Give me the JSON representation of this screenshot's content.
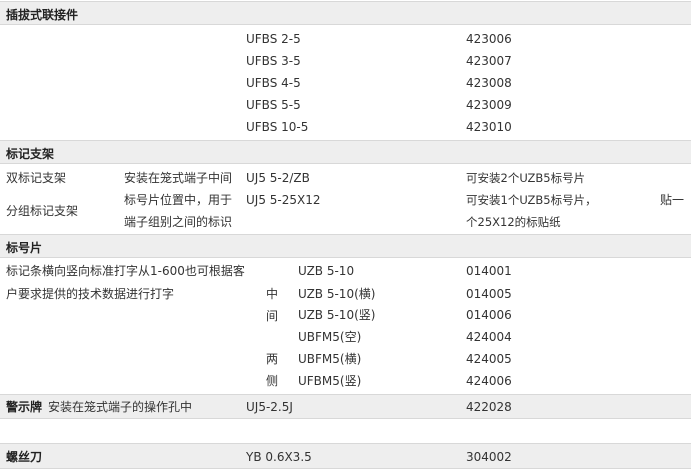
{
  "connectors": {
    "title": "插拔式联接件",
    "rows": [
      {
        "model": "UFBS 2-5",
        "code": "423006"
      },
      {
        "model": "UFBS 3-5",
        "code": "423007"
      },
      {
        "model": "UFBS 4-5",
        "code": "423008"
      },
      {
        "model": "UFBS 5-5",
        "code": "423009"
      },
      {
        "model": "UFBS 10-5",
        "code": "423010"
      }
    ]
  },
  "marker_bracket": {
    "title": "标记支架",
    "names": [
      "双标记支架",
      "分组标记支架"
    ],
    "desc": [
      "安装在笼式端子中间",
      "标号片位置中，用于",
      "端子组别之间的标识"
    ],
    "models": [
      "UJ5 5-2/ZB",
      "UJ5 5-25X12"
    ],
    "notes": [
      "可安装2个UZB5标号片",
      "可安装1个UZB5标号片，",
      "个25X12的标贴纸"
    ],
    "note_extra": "贴一"
  },
  "marker_strip": {
    "title": "标号片",
    "desc": [
      "标记条横向竖向标准打字从1-600也可根据客",
      "户要求提供的技术数据进行打字"
    ],
    "side_labels": [
      "中",
      "间",
      "两",
      "侧"
    ],
    "rows": [
      {
        "model": "UZB 5-10",
        "code": "014001"
      },
      {
        "model": "UZB 5-10(横)",
        "code": "014005"
      },
      {
        "model": "UZB 5-10(竖)",
        "code": "014006"
      },
      {
        "model": "UBFM5(空)",
        "code": "424004"
      },
      {
        "model": "UBFM5(横)",
        "code": "424005"
      },
      {
        "model": "UFBM5(竖)",
        "code": "424006"
      }
    ]
  },
  "warning": {
    "title": "警示牌",
    "desc": "安装在笼式端子的操作孔中",
    "model": "UJ5-2.5J",
    "code": "422028"
  },
  "screwdriver": {
    "title": "螺丝刀",
    "model": "YB 0.6X3.5",
    "code": "304002"
  }
}
